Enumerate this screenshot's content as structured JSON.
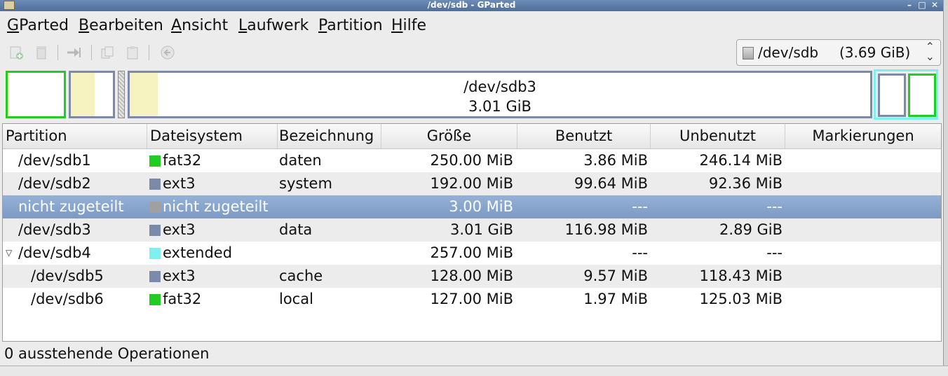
{
  "window": {
    "title": "/dev/sdb - GParted"
  },
  "menu": [
    {
      "accel": "G",
      "rest": "Parted"
    },
    {
      "accel": "B",
      "rest": "earbeiten"
    },
    {
      "accel": "A",
      "rest": "nsicht"
    },
    {
      "accel": "L",
      "rest": "aufwerk"
    },
    {
      "accel": "P",
      "rest": "artition"
    },
    {
      "accel": "H",
      "rest": "ilfe"
    }
  ],
  "toolbar": {
    "icons": [
      "new-partition-icon",
      "delete-icon",
      "resize-move-icon",
      "copy-icon",
      "paste-icon",
      "undo-icon",
      "apply-icon"
    ]
  },
  "device": {
    "name": "/dev/sdb",
    "size": "(3.69 GiB)"
  },
  "map": {
    "label_name": "/dev/sdb3",
    "label_size": "3.01 GiB"
  },
  "table": {
    "headers": [
      "Partition",
      "Dateisystem",
      "Bezeichnung",
      "Größe",
      "Benutzt",
      "Unbenutzt",
      "Markierungen"
    ],
    "rows": [
      {
        "partition": "/dev/sdb1",
        "fs": "fat32",
        "fs_color": "#22cc22",
        "label": "daten",
        "size": "250.00 MiB",
        "used": "3.86 MiB",
        "unused": "246.14 MiB",
        "flags": ""
      },
      {
        "partition": "/dev/sdb2",
        "fs": "ext3",
        "fs_color": "#7a8aa8",
        "label": "system",
        "size": "192.00 MiB",
        "used": "99.64 MiB",
        "unused": "92.36 MiB",
        "flags": ""
      },
      {
        "partition": "nicht zugeteilt",
        "fs": "nicht zugeteilt",
        "fs_color": "#a0a0a0",
        "label": "",
        "size": "3.00 MiB",
        "used": "---",
        "unused": "---",
        "flags": ""
      },
      {
        "partition": "/dev/sdb3",
        "fs": "ext3",
        "fs_color": "#7a8aa8",
        "label": "data",
        "size": "3.01 GiB",
        "used": "116.98 MiB",
        "unused": "2.89 GiB",
        "flags": ""
      },
      {
        "partition": "/dev/sdb4",
        "fs": "extended",
        "fs_color": "#7ff0f0",
        "label": "",
        "size": "257.00 MiB",
        "used": "---",
        "unused": "---",
        "flags": ""
      },
      {
        "partition": "/dev/sdb5",
        "fs": "ext3",
        "fs_color": "#7a8aa8",
        "label": "cache",
        "size": "128.00 MiB",
        "used": "9.57 MiB",
        "unused": "118.43 MiB",
        "flags": ""
      },
      {
        "partition": "/dev/sdb6",
        "fs": "fat32",
        "fs_color": "#22cc22",
        "label": "local",
        "size": "127.00 MiB",
        "used": "1.97 MiB",
        "unused": "125.03 MiB",
        "flags": ""
      }
    ]
  },
  "status": {
    "text": "0 ausstehende Operationen"
  },
  "colors": {
    "fat32": "#22cc22",
    "ext3": "#7a8aa8",
    "unallocated": "#a0a0a0",
    "extended": "#7ff0f0",
    "selection": "#7b9ac4",
    "used_fill": "#f6f3c0"
  }
}
